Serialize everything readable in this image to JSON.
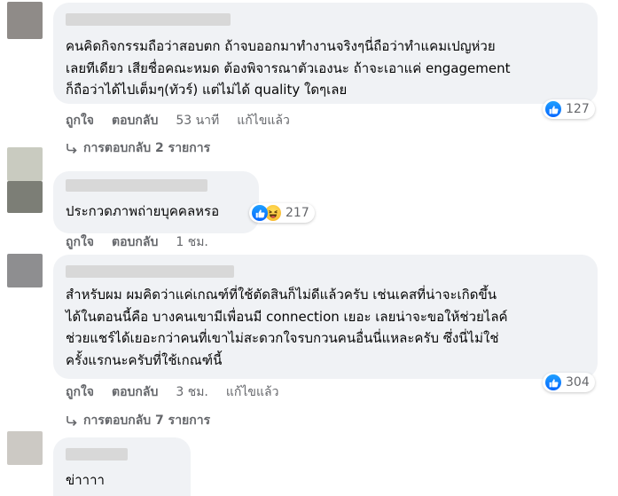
{
  "comments": [
    {
      "lines": [
        "คนคิดกิจกรรมถือว่าสอบตก ถ้าจบออกมาทำงานจริงๆนี่ถือว่าทำแคมเปญห่วย",
        "เลยทีเดียว เสียชื่อคณะหมด ต้องพิจารณาตัวเองนะ ถ้าจะเอาแค่ engagement",
        "ก็ถือว่าได้ไปเต็มๆ(ทัวร์) แต่ไม่ได้ quality ใดๆเลย"
      ],
      "like_label": "ถูกใจ",
      "reply_label": "ตอบกลับ",
      "time": "53 นาที",
      "edited": "แก้ไขแล้ว",
      "reactions": [
        "like-icon"
      ],
      "reaction_count": "127",
      "replies_label": "การตอบกลับ 2 รายการ"
    },
    {
      "lines": [
        "ประกวดภาพถ่ายบุคคลหรอ"
      ],
      "like_label": "ถูกใจ",
      "reply_label": "ตอบกลับ",
      "time": "1 ชม.",
      "reactions": [
        "like-icon",
        "haha-icon"
      ],
      "reaction_count": "217"
    },
    {
      "lines": [
        "สำหรับผม ผมคิดว่าแค่เกณฑ์ที่ใช้ตัดสินก็ไม่ดีแล้วครับ เช่นเคสที่น่าจะเกิดขึ้น",
        "ได้ในตอนนี้คือ บางคนเขามีเพื่อนมี connection เยอะ เลยน่าจะขอให้ช่วยไลค์",
        "ช่วยแชร์ได้เยอะกว่าคนที่เขาไม่สะดวกใจรบกวนคนอื่นนี่แหละครับ ซึ่งนี่ไม่ใช่",
        "ครั้งแรกนะครับที่ใช้เกณฑ์นี้"
      ],
      "like_label": "ถูกใจ",
      "reply_label": "ตอบกลับ",
      "time": "3 ชม.",
      "edited": "แก้ไขแล้ว",
      "reactions": [
        "like-icon"
      ],
      "reaction_count": "304",
      "replies_label": "การตอบกลับ 7 รายการ"
    },
    {
      "lines": [
        "ข่าาาา"
      ]
    }
  ],
  "colors": {
    "bubble": "#f0f2f5",
    "secondary_text": "#65676b",
    "like_blue": "#0566ff"
  }
}
